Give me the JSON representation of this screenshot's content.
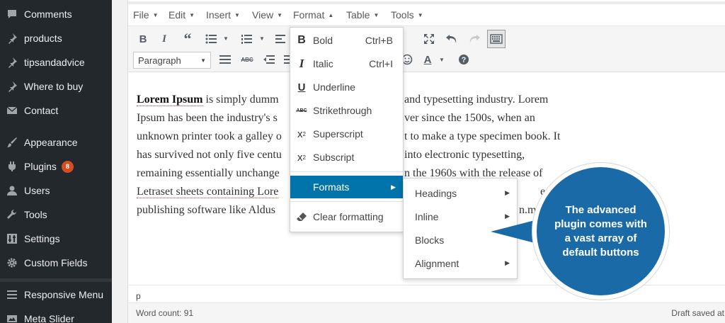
{
  "sidebar": {
    "items": [
      {
        "label": "Comments",
        "icon": "comment-icon"
      },
      {
        "label": "products",
        "icon": "pin-icon"
      },
      {
        "label": "tipsandadvice",
        "icon": "pin-icon"
      },
      {
        "label": "Where to buy",
        "icon": "pin-icon"
      },
      {
        "label": "Contact",
        "icon": "mail-icon"
      },
      {
        "label": "Appearance",
        "icon": "brush-icon"
      },
      {
        "label": "Plugins",
        "icon": "plugin-icon",
        "badge": "8"
      },
      {
        "label": "Users",
        "icon": "user-icon"
      },
      {
        "label": "Tools",
        "icon": "wrench-icon"
      },
      {
        "label": "Settings",
        "icon": "settings-icon"
      },
      {
        "label": "Custom Fields",
        "icon": "gear-icon"
      },
      {
        "label": "Responsive Menu",
        "icon": "menu-lines-icon"
      },
      {
        "label": "Meta Slider",
        "icon": "slider-icon"
      }
    ]
  },
  "menubar": {
    "items": [
      "File",
      "Edit",
      "Insert",
      "View",
      "Format",
      "Table",
      "Tools"
    ]
  },
  "toolbar": {
    "paragraph_select": "Paragraph"
  },
  "content": {
    "bold_lead": "Lorem Ipsum",
    "lines": [
      " is simply dumm",
      "and typesetting industry. Lorem",
      "Ipsum has been the industry's s",
      "ver since the 1500s, when an",
      "unknown printer took a galley o",
      "t to make a type specimen book. It",
      "has survived not only five centu",
      "into electronic typesetting,",
      "remaining essentially unchange",
      "n the 1960s with the release of",
      "Letraset sheets containing Lore",
      "esktop",
      "publishing software like Aldus",
      "n.m"
    ]
  },
  "status": {
    "path": "p",
    "word_count": "Word count: 91",
    "draft": "Draft saved at"
  },
  "format_menu": {
    "items": [
      {
        "label": "Bold",
        "shortcut": "Ctrl+B",
        "icon": "bold-icon"
      },
      {
        "label": "Italic",
        "shortcut": "Ctrl+I",
        "icon": "italic-icon"
      },
      {
        "label": "Underline",
        "icon": "underline-icon"
      },
      {
        "label": "Strikethrough",
        "icon": "strikethrough-icon"
      },
      {
        "label": "Superscript",
        "icon": "superscript-icon"
      },
      {
        "label": "Subscript",
        "icon": "subscript-icon"
      },
      {
        "label": "Formats",
        "icon": "",
        "active": true
      },
      {
        "label": "Clear formatting",
        "icon": "eraser-icon"
      }
    ],
    "formats_submenu": [
      "Headings",
      "Inline",
      "Blocks",
      "Alignment"
    ]
  },
  "callout": {
    "text": "The advanced plugin comes with a vast array of default buttons"
  },
  "colors": {
    "sidebar_bg": "#23282d",
    "accent": "#0073aa",
    "callout": "#1a6aa8",
    "badge": "#d54e21"
  }
}
